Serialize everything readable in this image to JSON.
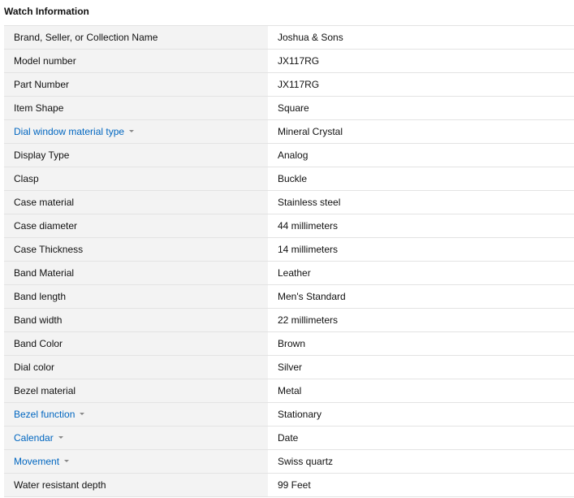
{
  "section": {
    "title": "Watch Information"
  },
  "rows": [
    {
      "label": "Brand, Seller, or Collection Name",
      "value": "Joshua & Sons",
      "link": false
    },
    {
      "label": "Model number",
      "value": "JX117RG",
      "link": false
    },
    {
      "label": "Part Number",
      "value": "JX117RG",
      "link": false
    },
    {
      "label": "Item Shape",
      "value": "Square",
      "link": false
    },
    {
      "label": "Dial window material type",
      "value": "Mineral Crystal",
      "link": true
    },
    {
      "label": "Display Type",
      "value": "Analog",
      "link": false
    },
    {
      "label": "Clasp",
      "value": "Buckle",
      "link": false
    },
    {
      "label": "Case material",
      "value": "Stainless steel",
      "link": false
    },
    {
      "label": "Case diameter",
      "value": "44 millimeters",
      "link": false
    },
    {
      "label": "Case Thickness",
      "value": "14 millimeters",
      "link": false
    },
    {
      "label": "Band Material",
      "value": "Leather",
      "link": false
    },
    {
      "label": "Band length",
      "value": "Men's Standard",
      "link": false
    },
    {
      "label": "Band width",
      "value": "22 millimeters",
      "link": false
    },
    {
      "label": "Band Color",
      "value": "Brown",
      "link": false
    },
    {
      "label": "Dial color",
      "value": "Silver",
      "link": false
    },
    {
      "label": "Bezel material",
      "value": "Metal",
      "link": false
    },
    {
      "label": "Bezel function",
      "value": "Stationary",
      "link": true
    },
    {
      "label": "Calendar",
      "value": "Date",
      "link": true
    },
    {
      "label": "Movement",
      "value": "Swiss quartz",
      "link": true
    },
    {
      "label": "Water resistant depth",
      "value": "99 Feet",
      "link": false
    }
  ],
  "colors": {
    "link": "#0066c0",
    "label_background": "#f3f3f3",
    "border": "#e3e3e3"
  },
  "icons": {
    "expand": "caret-down-icon"
  }
}
